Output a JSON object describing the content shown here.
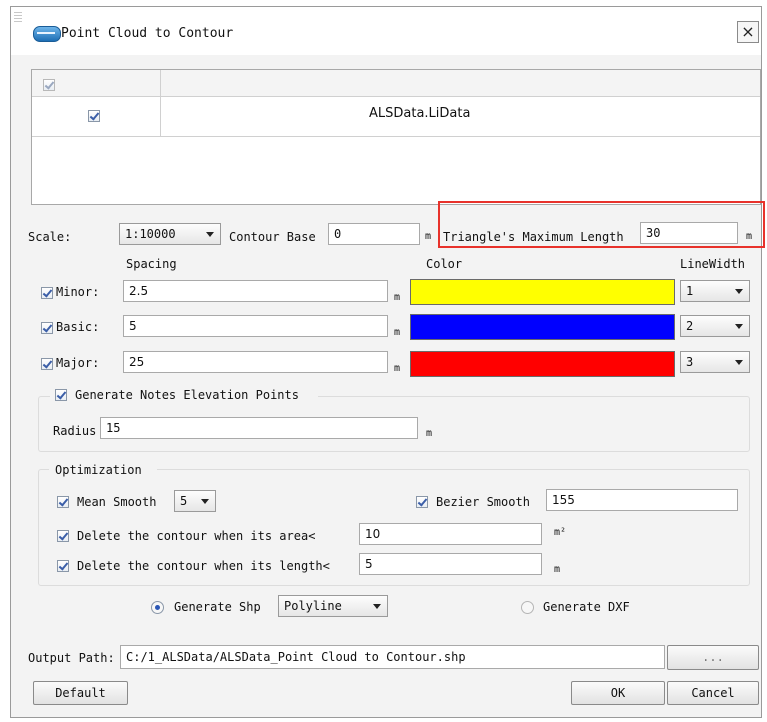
{
  "window": {
    "title": "Point Cloud to Contour",
    "close_label": "×"
  },
  "table": {
    "row_name": "ALSData.LiData",
    "header_checked": true,
    "row_checked": true
  },
  "params": {
    "scale_label": "Scale:",
    "scale_value": "1:10000",
    "contour_base_label": "Contour Base",
    "contour_base_value": "0",
    "contour_base_unit": "m",
    "triangle_label": "Triangle's Maximum Length",
    "triangle_value": "30",
    "triangle_unit": "m"
  },
  "columns": {
    "spacing": "Spacing",
    "color": "Color",
    "linewidth": "LineWidth"
  },
  "contours": [
    {
      "label": "Minor:",
      "spacing": "2.5",
      "unit": "m",
      "color": "#ffff00",
      "linewidth": "1",
      "checked": true
    },
    {
      "label": "Basic:",
      "spacing": "5",
      "unit": "m",
      "color": "#0000ff",
      "linewidth": "2",
      "checked": true
    },
    {
      "label": "Major:",
      "spacing": "25",
      "unit": "m",
      "color": "#ff0000",
      "linewidth": "3",
      "checked": true
    }
  ],
  "notes": {
    "label": "Generate Notes Elevation Points",
    "checked": true,
    "radius_label": "Radius",
    "radius_value": "15",
    "radius_unit": "m"
  },
  "optimization": {
    "title": "Optimization",
    "mean_smooth_label": "Mean Smooth",
    "mean_smooth_value": "5",
    "bezier_smooth_label": "Bezier Smooth",
    "bezier_smooth_value": "155",
    "area_label": "Delete the contour when its area<",
    "area_value": "10",
    "area_unit": "m²",
    "length_label": "Delete the contour when its length<",
    "length_value": "5",
    "length_unit": "m"
  },
  "output": {
    "shp_label": "Generate Shp",
    "shp_type": "Polyline",
    "shp_selected": true,
    "dxf_label": "Generate DXF",
    "path_label": "Output Path:",
    "path_value": "C:/1_ALSData/ALSData_Point Cloud to Contour.shp",
    "browse_label": "..."
  },
  "buttons": {
    "default": "Default",
    "ok": "OK",
    "cancel": "Cancel"
  },
  "colors": {
    "highlight": "#e8322b"
  }
}
